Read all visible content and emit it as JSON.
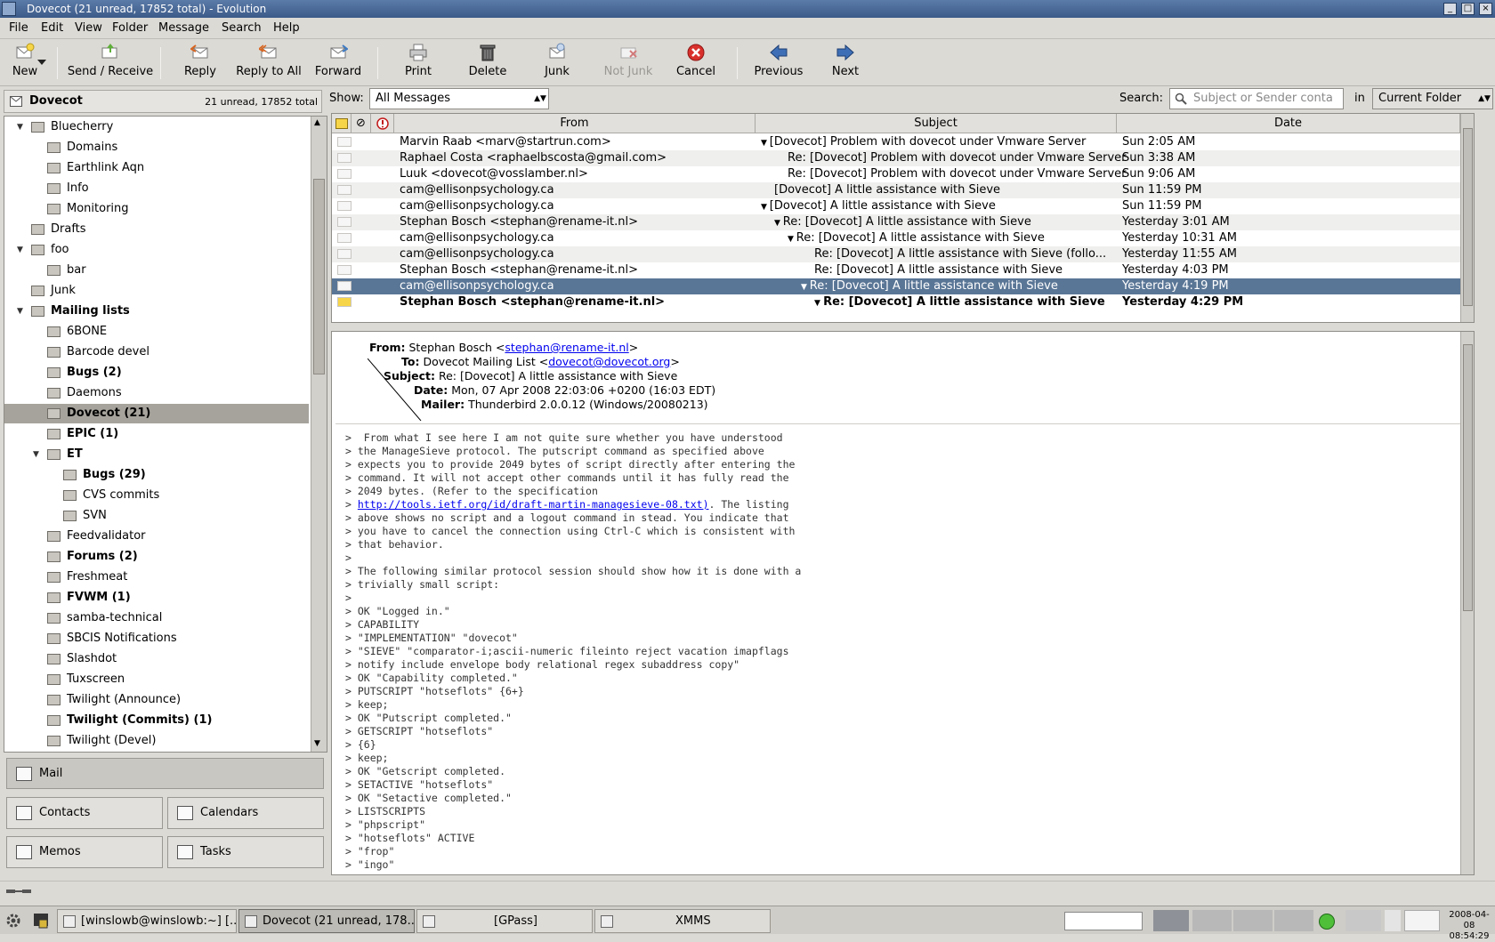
{
  "window": {
    "title": "Dovecot (21 unread, 17852 total) - Evolution"
  },
  "menu": [
    "File",
    "Edit",
    "View",
    "Folder",
    "Message",
    "Search",
    "Help"
  ],
  "toolbar": {
    "new": "New",
    "send_receive": "Send / Receive",
    "reply": "Reply",
    "reply_all": "Reply to All",
    "forward": "Forward",
    "print": "Print",
    "delete": "Delete",
    "junk": "Junk",
    "not_junk": "Not Junk",
    "cancel": "Cancel",
    "previous": "Previous",
    "next": "Next"
  },
  "sidebar": {
    "account": "Dovecot",
    "counts": "21 unread, 17852 total",
    "folders": [
      {
        "label": "Bluecherry",
        "level": 1,
        "expanded": true,
        "bold": false
      },
      {
        "label": "Domains",
        "level": 2,
        "bold": false
      },
      {
        "label": "Earthlink Aqn",
        "level": 2,
        "bold": false
      },
      {
        "label": "Info",
        "level": 2,
        "bold": false
      },
      {
        "label": "Monitoring",
        "level": 2,
        "bold": false
      },
      {
        "label": "Drafts",
        "level": 1,
        "bold": false
      },
      {
        "label": "foo",
        "level": 1,
        "expanded": true,
        "bold": false
      },
      {
        "label": "bar",
        "level": 2,
        "bold": false
      },
      {
        "label": "Junk",
        "level": 1,
        "bold": false
      },
      {
        "label": "Mailing lists",
        "level": 1,
        "expanded": true,
        "bold": true
      },
      {
        "label": "6BONE",
        "level": 2,
        "bold": false
      },
      {
        "label": "Barcode devel",
        "level": 2,
        "bold": false
      },
      {
        "label": "Bugs (2)",
        "level": 2,
        "bold": true
      },
      {
        "label": "Daemons",
        "level": 2,
        "bold": false
      },
      {
        "label": "Dovecot (21)",
        "level": 2,
        "bold": true,
        "selected": true
      },
      {
        "label": "EPIC (1)",
        "level": 2,
        "bold": true
      },
      {
        "label": "ET",
        "level": 2,
        "expanded": true,
        "bold": true
      },
      {
        "label": "Bugs (29)",
        "level": 3,
        "bold": true
      },
      {
        "label": "CVS commits",
        "level": 3,
        "bold": false
      },
      {
        "label": "SVN",
        "level": 3,
        "bold": false
      },
      {
        "label": "Feedvalidator",
        "level": 2,
        "bold": false
      },
      {
        "label": "Forums (2)",
        "level": 2,
        "bold": true
      },
      {
        "label": "Freshmeat",
        "level": 2,
        "bold": false
      },
      {
        "label": "FVWM (1)",
        "level": 2,
        "bold": true
      },
      {
        "label": "samba-technical",
        "level": 2,
        "bold": false
      },
      {
        "label": "SBCIS Notifications",
        "level": 2,
        "bold": false
      },
      {
        "label": "Slashdot",
        "level": 2,
        "bold": false
      },
      {
        "label": "Tuxscreen",
        "level": 2,
        "bold": false
      },
      {
        "label": "Twilight (Announce)",
        "level": 2,
        "bold": false
      },
      {
        "label": "Twilight (Commits) (1)",
        "level": 2,
        "bold": true
      },
      {
        "label": "Twilight (Devel)",
        "level": 2,
        "bold": false
      }
    ]
  },
  "switcher": {
    "mail": "Mail",
    "contacts": "Contacts",
    "calendars": "Calendars",
    "memos": "Memos",
    "tasks": "Tasks"
  },
  "filter": {
    "show_label": "Show:",
    "show_value": "All Messages",
    "search_label": "Search:",
    "search_placeholder": "Subject or Sender conta",
    "in_label": "in",
    "scope": "Current Folder"
  },
  "columns": {
    "from": "From",
    "subject": "Subject",
    "date": "Date"
  },
  "messages": [
    {
      "from": "Marvin Raab <marv@startrun.com>",
      "subject": "[Dovecot] Problem with dovecot under Vmware Server",
      "date": "Sun 2:05 AM",
      "indent": 0,
      "thread": true
    },
    {
      "from": "Raphael Costa <raphaelbscosta@gmail.com>",
      "subject": "Re: [Dovecot] Problem with dovecot under Vmware Server",
      "date": "Sun 3:38 AM",
      "indent": 1
    },
    {
      "from": "Luuk <dovecot@vosslamber.nl>",
      "subject": "Re: [Dovecot] Problem with dovecot under Vmware Server",
      "date": "Sun 9:06 AM",
      "indent": 1
    },
    {
      "from": "cam@ellisonpsychology.ca",
      "subject": "[Dovecot] A little assistance with Sieve",
      "date": "Sun 11:59 PM",
      "indent": 0
    },
    {
      "from": "cam@ellisonpsychology.ca",
      "subject": "[Dovecot] A little assistance with Sieve",
      "date": "Sun 11:59 PM",
      "indent": 0,
      "thread": true
    },
    {
      "from": "Stephan Bosch <stephan@rename-it.nl>",
      "subject": "Re: [Dovecot] A little assistance with Sieve",
      "date": "Yesterday 3:01 AM",
      "indent": 1,
      "thread": true
    },
    {
      "from": "cam@ellisonpsychology.ca",
      "subject": "Re: [Dovecot] A little assistance with Sieve",
      "date": "Yesterday 10:31 AM",
      "indent": 2,
      "thread": true
    },
    {
      "from": "cam@ellisonpsychology.ca",
      "subject": "Re: [Dovecot] A little assistance with Sieve (follo...",
      "date": "Yesterday 11:55 AM",
      "indent": 3
    },
    {
      "from": "Stephan Bosch <stephan@rename-it.nl>",
      "subject": "Re: [Dovecot] A little assistance with Sieve",
      "date": "Yesterday 4:03 PM",
      "indent": 3
    },
    {
      "from": "cam@ellisonpsychology.ca",
      "subject": "Re: [Dovecot] A little assistance with Sieve",
      "date": "Yesterday 4:19 PM",
      "indent": 3,
      "thread": true,
      "selected": true
    },
    {
      "from": "Stephan Bosch <stephan@rename-it.nl>",
      "subject": "Re: [Dovecot] A little assistance with Sieve",
      "date": "Yesterday 4:29 PM",
      "indent": 4,
      "thread": true,
      "bold": true
    }
  ],
  "preview": {
    "from_label": "From:",
    "from_name": "Stephan Bosch <",
    "from_email": "stephan@rename-it.nl",
    "from_close": ">",
    "to_label": "To:",
    "to_name": "Dovecot Mailing List <",
    "to_email": "dovecot@dovecot.org",
    "to_close": ">",
    "subject_label": "Subject:",
    "subject": "Re: [Dovecot] A little assistance with Sieve",
    "date_label": "Date:",
    "date": "Mon, 07 Apr 2008 22:03:06 +0200 (16:03 EDT)",
    "mailer_label": "Mailer:",
    "mailer": "Thunderbird 2.0.0.12 (Windows/20080213)",
    "body_before_link": ">  From what I see here I am not quite sure whether you have understood\n> the ManageSieve protocol. The putscript command as specified above\n> expects you to provide 2049 bytes of script directly after entering the\n> command. It will not accept other commands until it has fully read the\n> 2049 bytes. (Refer to the specification\n> ",
    "body_link": "http://tools.ietf.org/id/draft-martin-managesieve-08.txt)",
    "body_after_link": ". The listing\n> above shows no script and a logout command in stead. You indicate that\n> you have to cancel the connection using Ctrl-C which is consistent with\n> that behavior.\n>\n> The following similar protocol session should show how it is done with a\n> trivially small script:\n>\n> OK \"Logged in.\"\n> CAPABILITY\n> \"IMPLEMENTATION\" \"dovecot\"\n> \"SIEVE\" \"comparator-i;ascii-numeric fileinto reject vacation imapflags\n> notify include envelope body relational regex subaddress copy\"\n> OK \"Capability completed.\"\n> PUTSCRIPT \"hotseflots\" {6+}\n> keep;\n> OK \"Putscript completed.\"\n> GETSCRIPT \"hotseflots\"\n> {6}\n> keep;\n> OK \"Getscript completed.\n> SETACTIVE \"hotseflots\"\n> OK \"Setactive completed.\"\n> LISTSCRIPTS\n> \"phpscript\"\n> \"hotseflots\" ACTIVE\n> \"frop\"\n> \"ingo\""
  },
  "taskbar": {
    "tasks": [
      "[winslowb@winslowb:~] [...",
      "Dovecot (21 unread, 178...",
      "[GPass]",
      "XMMS"
    ],
    "clock_date": "2008-04-08",
    "clock_time": "08:54:29"
  }
}
